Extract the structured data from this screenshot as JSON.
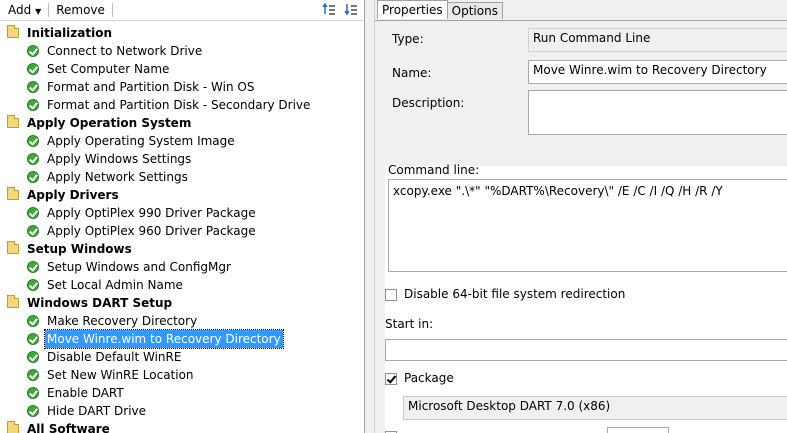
{
  "toolbar": {
    "add_label": "Add",
    "add_dropdown_icon": "caret-down-icon",
    "remove_label": "Remove"
  },
  "tree": {
    "groups": [
      {
        "label": "Initialization",
        "steps": [
          "Connect to Network Drive",
          "Set Computer Name",
          "Format and Partition Disk - Win OS",
          "Format and Partition Disk - Secondary Drive"
        ]
      },
      {
        "label": "Apply Operation System",
        "steps": [
          "Apply Operating System Image",
          "Apply Windows Settings",
          "Apply Network Settings"
        ]
      },
      {
        "label": "Apply Drivers",
        "steps": [
          "Apply OptiPlex 990 Driver Package",
          "Apply OptiPlex 960 Driver Package"
        ]
      },
      {
        "label": "Setup Windows",
        "steps": [
          "Setup Windows and ConfigMgr",
          "Set Local Admin Name"
        ]
      },
      {
        "label": "Windows DART Setup",
        "steps": [
          "Make Recovery Directory",
          "Move Winre.wim to Recovery Directory",
          "Disable Default WinRE",
          "Set New WinRE Location",
          "Enable DART",
          "Hide DART Drive"
        ]
      },
      {
        "label": "All Software",
        "steps": []
      }
    ],
    "selected_step": "Move Winre.wim to Recovery Directory"
  },
  "tabs": {
    "properties": "Properties",
    "options": "Options"
  },
  "properties": {
    "type_label": "Type:",
    "type_value": "Run Command Line",
    "name_label": "Name:",
    "name_value": "Move Winre.wim to Recovery Directory",
    "description_label": "Description:",
    "description_value": "",
    "command_line_label": "Command line:",
    "command_line_value": "xcopy.exe \".\\*\" \"%DART%\\Recovery\\\" /E /C /I /Q /H /R /Y",
    "disable_64bit_label": "Disable 64-bit file system redirection",
    "disable_64bit_checked": false,
    "start_in_label": "Start in:",
    "start_in_value": "",
    "package_label": "Package",
    "package_checked": true,
    "package_value": "Microsoft Desktop DART 7.0 (x86)"
  },
  "colors": {
    "selection": "#3399ff",
    "check_green": "#3faa3a",
    "folder_yellow": "#f4d67b",
    "panel_gray": "#f0f0f0"
  }
}
